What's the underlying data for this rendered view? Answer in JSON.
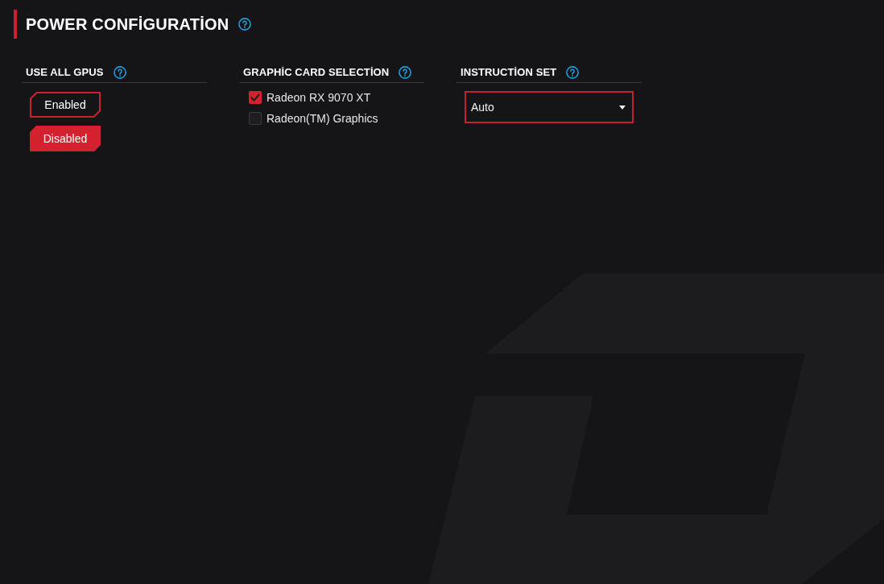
{
  "page": {
    "title": "POWER CONFİGURATİON"
  },
  "sections": [
    {
      "kind": "toggle",
      "title": "USE ALL GPUS",
      "options": [
        {
          "label": "Enabled",
          "selected": false
        },
        {
          "label": "Disabled",
          "selected": true
        }
      ]
    },
    {
      "kind": "checklist",
      "title": "GRAPHİC CARD SELECTİON",
      "items": [
        {
          "label": "Radeon RX 9070 XT",
          "checked": true
        },
        {
          "label": "Radeon(TM) Graphics",
          "checked": false
        }
      ]
    },
    {
      "kind": "dropdown",
      "title": "INSTRUCTİON SET",
      "value": "Auto"
    }
  ]
}
